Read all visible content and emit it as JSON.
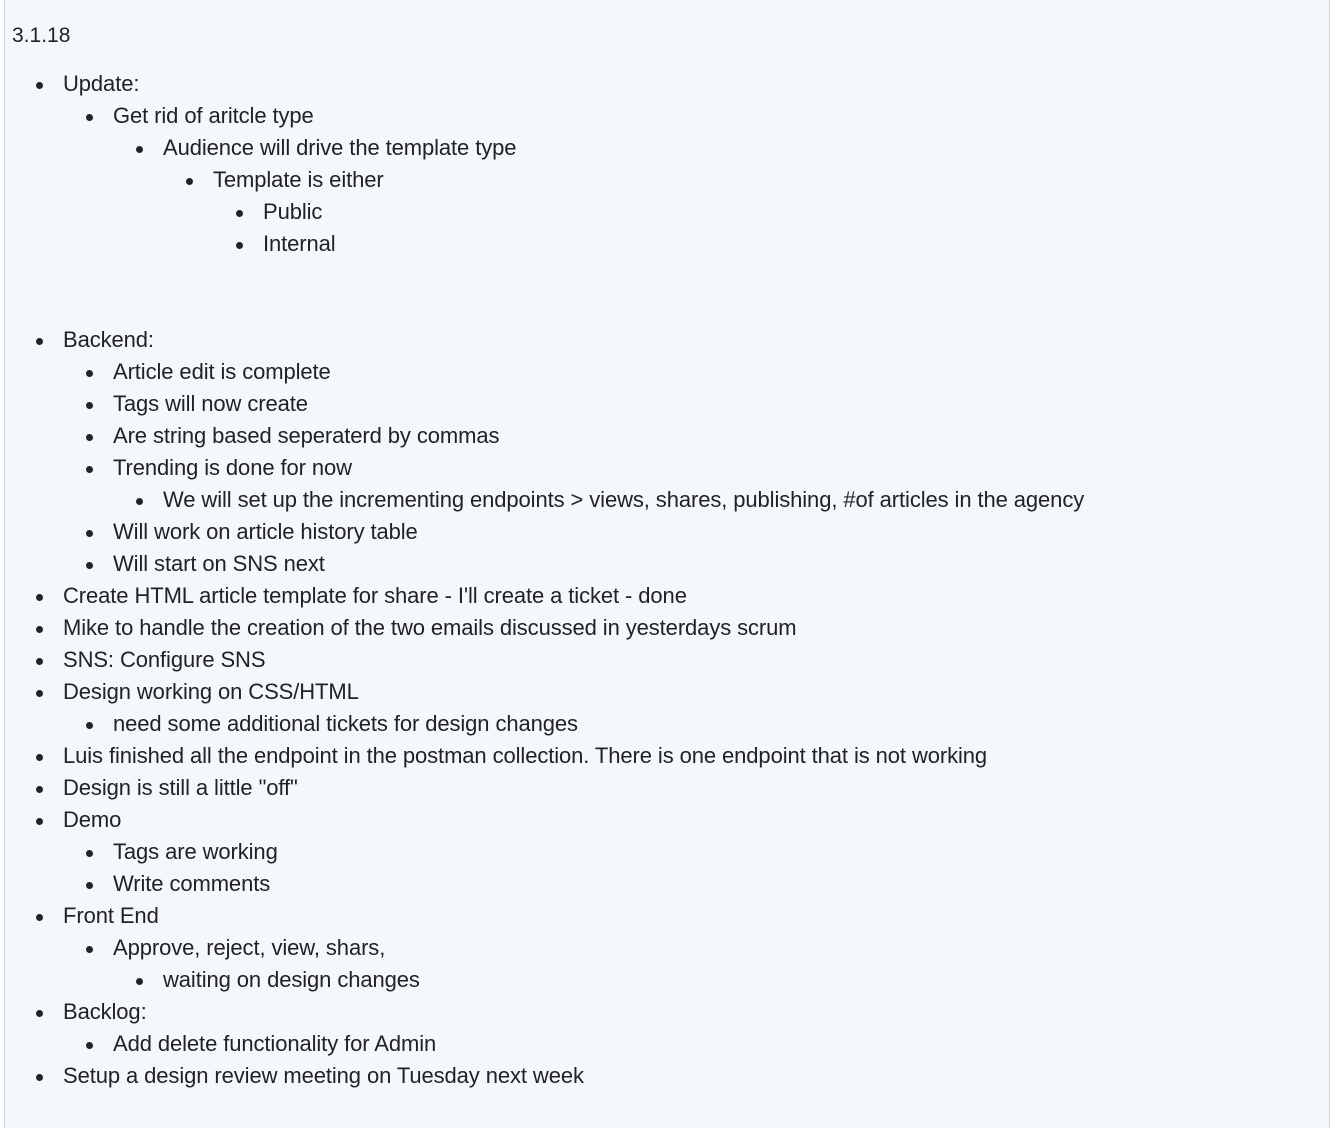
{
  "heading": "3.1.18",
  "items": [
    {
      "level": 1,
      "text": "Update:"
    },
    {
      "level": 2,
      "text": "Get rid of aritcle type"
    },
    {
      "level": 3,
      "text": "Audience will drive the template type"
    },
    {
      "level": 4,
      "text": "Template is either"
    },
    {
      "level": 5,
      "text": "Public"
    },
    {
      "level": 5,
      "text": "Internal"
    },
    {
      "level": 0,
      "text": ""
    },
    {
      "level": 1,
      "text": " Backend:"
    },
    {
      "level": 2,
      "text": "Article edit is complete"
    },
    {
      "level": 2,
      "text": "Tags will now create"
    },
    {
      "level": 2,
      "text": "Are string based seperaterd by commas"
    },
    {
      "level": 2,
      "text": "Trending is done for now"
    },
    {
      "level": 3,
      "text": "We will set up the incrementing endpoints > views, shares, publishing, #of articles in the agency"
    },
    {
      "level": 2,
      "text": "Will work on article history table"
    },
    {
      "level": 2,
      "text": "Will start on SNS next"
    },
    {
      "level": 1,
      "text": "Create HTML article template for share - I'll create a ticket - done"
    },
    {
      "level": 1,
      "text": "Mike to handle the creation of the two emails discussed in yesterdays scrum"
    },
    {
      "level": 1,
      "text": "SNS:  Configure SNS"
    },
    {
      "level": 1,
      "text": "Design working on CSS/HTML"
    },
    {
      "level": 2,
      "text": "need some additional tickets for design changes"
    },
    {
      "level": 1,
      "text": "Luis finished all the endpoint in the postman collection.  There is one endpoint that is not working"
    },
    {
      "level": 1,
      "text": "Design is still a little \"off\""
    },
    {
      "level": 1,
      "text": " Demo"
    },
    {
      "level": 2,
      "text": "Tags are working"
    },
    {
      "level": 2,
      "text": "Write comments"
    },
    {
      "level": 1,
      "text": "Front End"
    },
    {
      "level": 2,
      "text": "Approve, reject, view, shars,"
    },
    {
      "level": 3,
      "text": "waiting on design changes"
    },
    {
      "level": 1,
      "text": "Backlog:"
    },
    {
      "level": 2,
      "text": "Add delete functionality for Admin"
    },
    {
      "level": 1,
      "text": "Setup a design review meeting on Tuesday next week"
    }
  ]
}
